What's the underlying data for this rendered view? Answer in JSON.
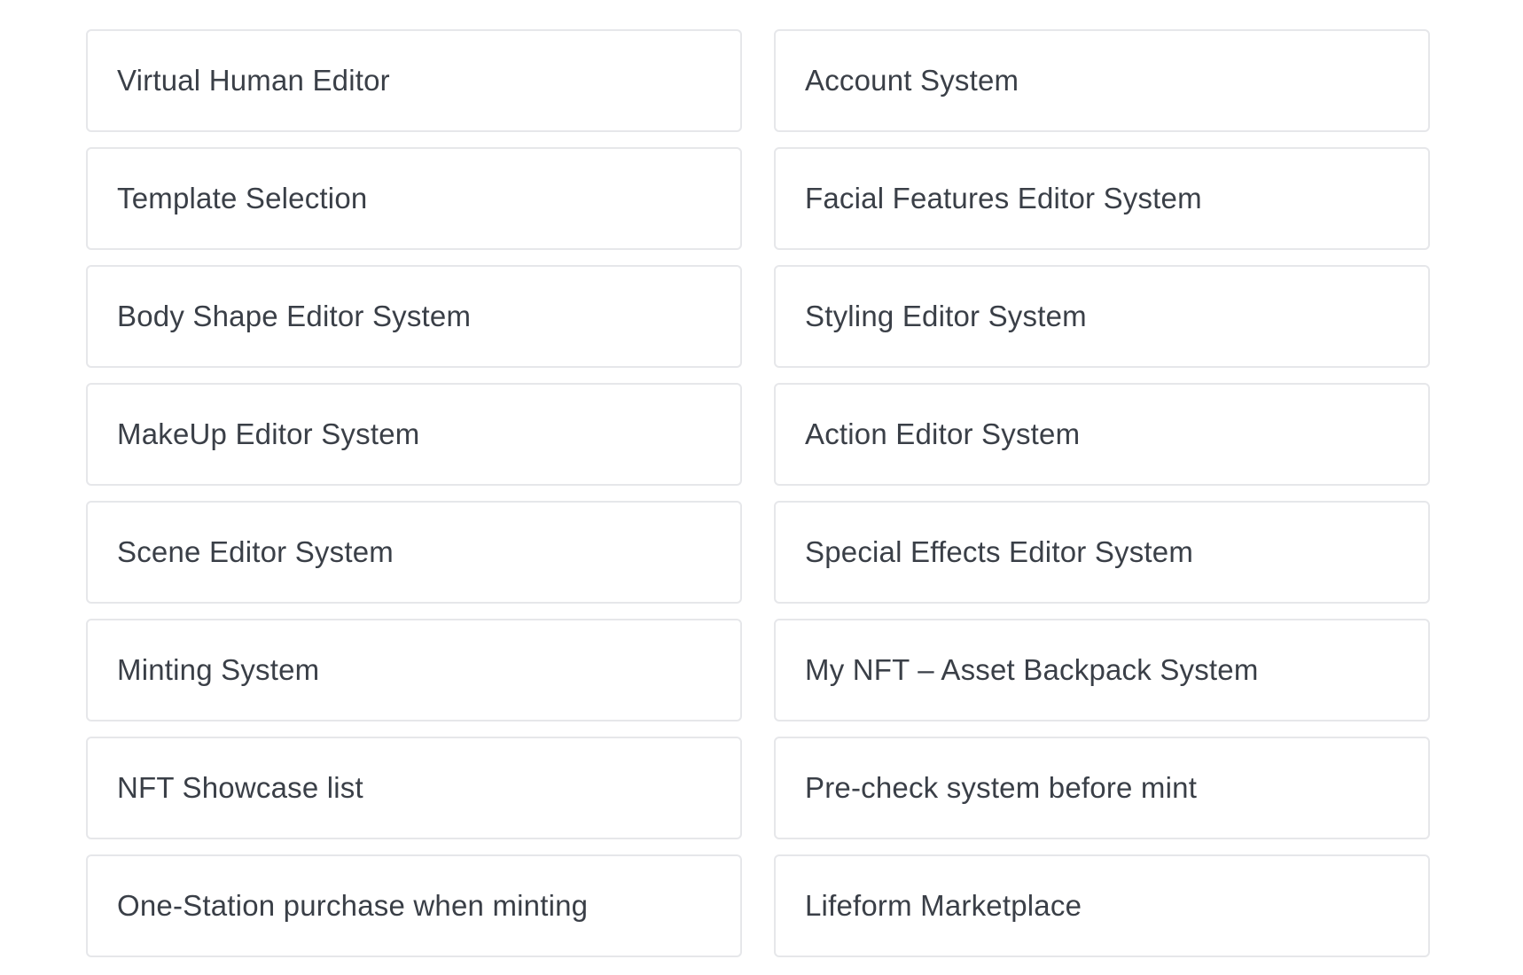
{
  "features": {
    "items": [
      {
        "label": "Virtual Human Editor"
      },
      {
        "label": "Account System"
      },
      {
        "label": "Template Selection"
      },
      {
        "label": "Facial Features Editor System"
      },
      {
        "label": "Body Shape Editor System"
      },
      {
        "label": "Styling Editor System"
      },
      {
        "label": "MakeUp Editor System"
      },
      {
        "label": "Action Editor System"
      },
      {
        "label": "Scene Editor System"
      },
      {
        "label": "Special Effects Editor System"
      },
      {
        "label": "Minting System"
      },
      {
        "label": "My NFT – Asset Backpack System"
      },
      {
        "label": "NFT Showcase list"
      },
      {
        "label": "Pre-check system before mint"
      },
      {
        "label": "One-Station purchase when minting"
      },
      {
        "label": "Lifeform Marketplace"
      }
    ]
  },
  "colors": {
    "background": "#ffffff",
    "card_border": "#e6e7ea",
    "text": "#3a3f47"
  }
}
